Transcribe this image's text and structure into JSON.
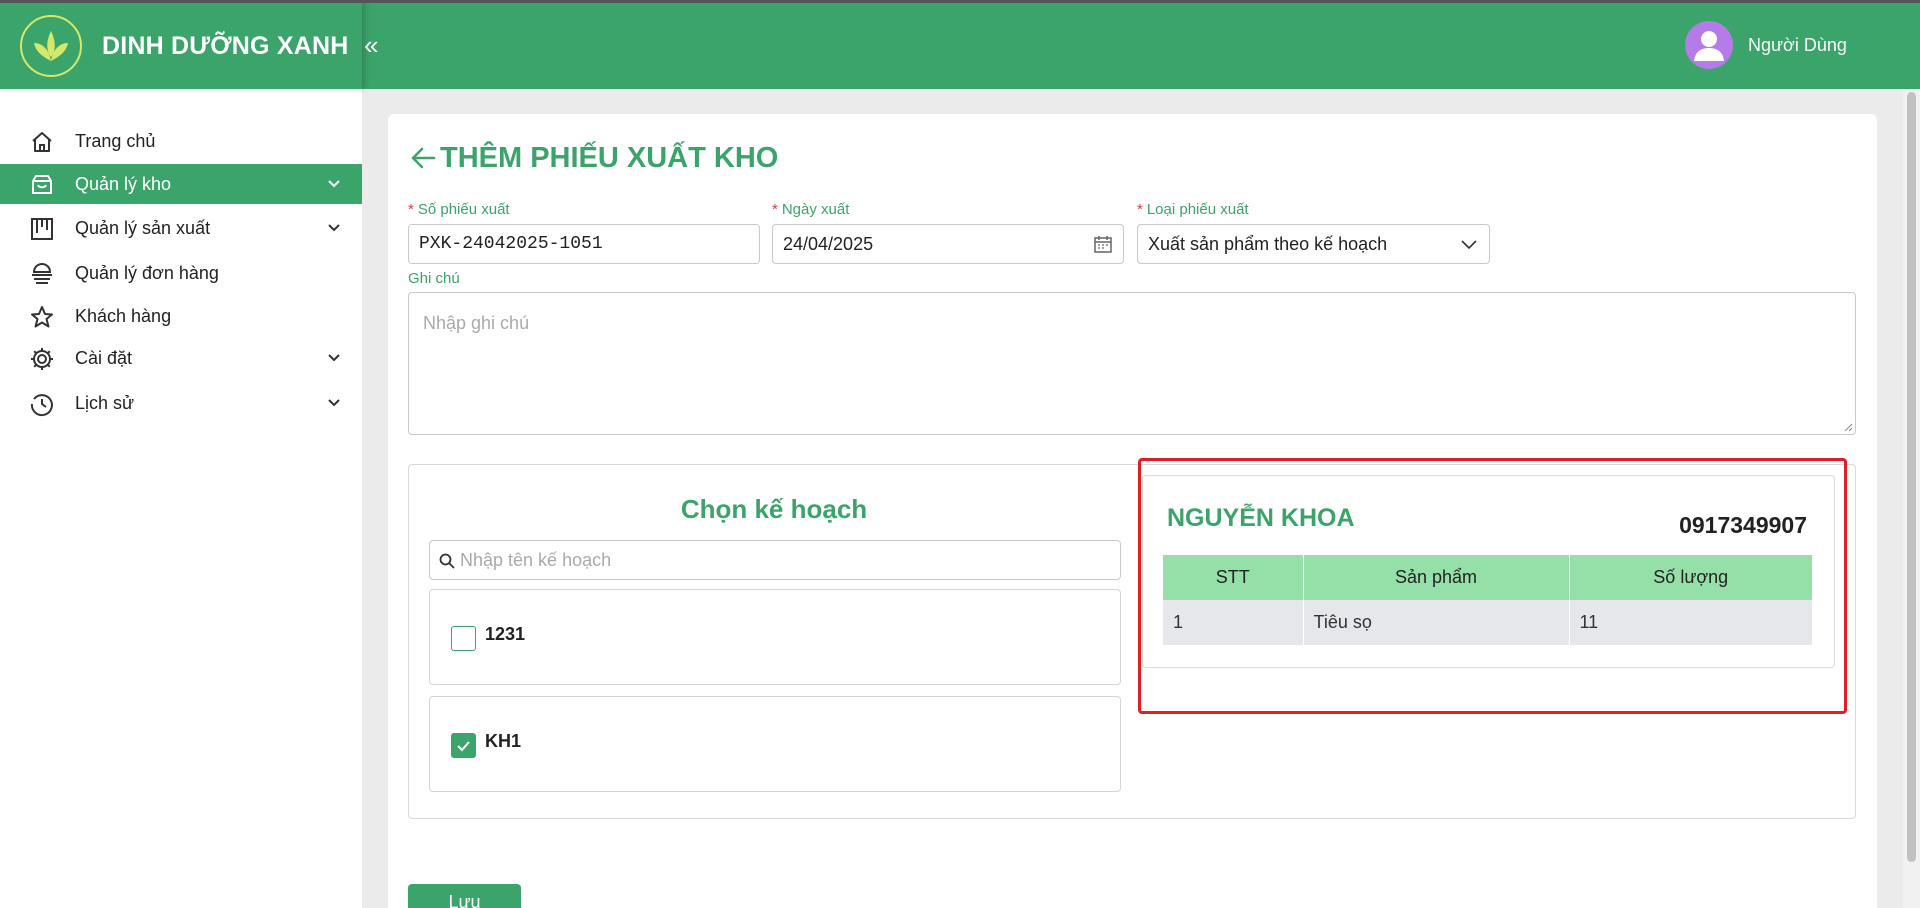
{
  "header": {
    "brand": "DINH DƯỠNG XANH",
    "collapse_glyph": "«",
    "user_name": "Người Dùng",
    "accent": "#3ba46a"
  },
  "sidebar": {
    "items": [
      {
        "label": "Trang chủ",
        "icon": "home-icon"
      },
      {
        "label": "Quản lý kho",
        "icon": "warehouse-icon",
        "active": true,
        "expandable": true
      },
      {
        "label": "Quản lý sản xuất",
        "icon": "production-icon",
        "expandable": true
      },
      {
        "label": "Quản lý đơn hàng",
        "icon": "orders-icon"
      },
      {
        "label": "Khách hàng",
        "icon": "star-icon"
      },
      {
        "label": "Cài đặt",
        "icon": "gear-icon",
        "expandable": true
      },
      {
        "label": "Lịch sử",
        "icon": "history-icon",
        "expandable": true
      }
    ]
  },
  "form": {
    "title": "THÊM PHIẾU XUẤT KHO",
    "required_mark": "*",
    "voucher_no_label": "Số phiếu xuất",
    "voucher_no_value": "PXK-24042025-1051",
    "date_label": "Ngày xuất",
    "date_value": "24/04/2025",
    "type_label": "Loại phiếu xuất",
    "type_value": "Xuất sản phẩm theo kế hoạch",
    "note_label": "Ghi chú",
    "note_placeholder": "Nhập ghi chú",
    "save_label": "Lưu"
  },
  "plans": {
    "title": "Chọn kế hoạch",
    "search_placeholder": "Nhập tên kế hoạch",
    "items": [
      {
        "code": "1231",
        "checked": false
      },
      {
        "code": "KH1",
        "checked": true
      }
    ]
  },
  "detail": {
    "customer_name": "NGUYỄN KHOA",
    "phone": "0917349907",
    "columns": [
      "STT",
      "Sản phẩm",
      "Số lượng"
    ],
    "rows": [
      {
        "stt": "1",
        "product": "Tiêu sọ",
        "qty": "11"
      }
    ],
    "highlight_color": "#e02020"
  }
}
